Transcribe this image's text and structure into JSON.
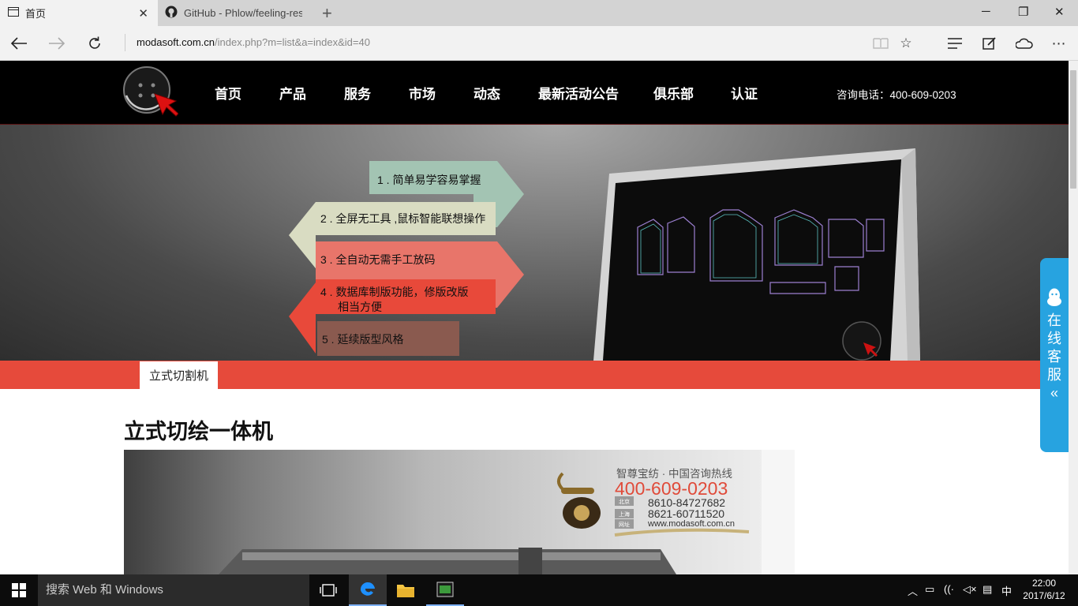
{
  "browser": {
    "tabs": [
      {
        "title": "首页",
        "active": true
      },
      {
        "title": "GitHub - Phlow/feeling-resp",
        "active": false
      }
    ],
    "address": {
      "host": "modasoft.com.cn",
      "path": "/index.php?m=list&a=index&id=40"
    }
  },
  "site": {
    "nav": [
      "首页",
      "产品",
      "服务",
      "市场",
      "动态",
      "最新活动公告",
      "俱乐部",
      "认证"
    ],
    "hotline": "咨询电话：400-609-0203",
    "banner": {
      "features": [
        {
          "label": "1 . 简单易学容易掌握",
          "color": "#a3c4b3"
        },
        {
          "label": "2 . 全屏无工具 ,鼠标智能联想操作",
          "color": "#d9dcc2"
        },
        {
          "label": "3 . 全自动无需手工放码",
          "color": "#e8756a"
        },
        {
          "label": "4 . 数据库制版功能，修版改版",
          "label2": "相当方便",
          "color": "#e8493a"
        },
        {
          "label": "5 . 延续版型风格",
          "color": "#8a5a4f"
        }
      ]
    },
    "section_tab": "立式切割机",
    "article_title": "立式切绘一体机",
    "product_image": {
      "slogan": "智尊宝纺 · 中国咨询热线",
      "phone": "400-609-0203",
      "tel1_tag": "北京",
      "tel1": "8610-84727682",
      "tel2_tag": "上海",
      "tel2": "8621-60711520",
      "web_tag": "网址",
      "website": "www.modasoft.com.cn"
    },
    "qq_widget": {
      "text": [
        "在",
        "线",
        "客",
        "服"
      ],
      "chevron": "«"
    }
  },
  "taskbar": {
    "search_placeholder": "搜索 Web 和 Windows",
    "ime": "中",
    "time": "22:00",
    "date": "2017/6/12"
  },
  "colors": {
    "accent_red": "#e64a3b",
    "qq_blue": "#27a3e0",
    "header_black": "#000000"
  }
}
